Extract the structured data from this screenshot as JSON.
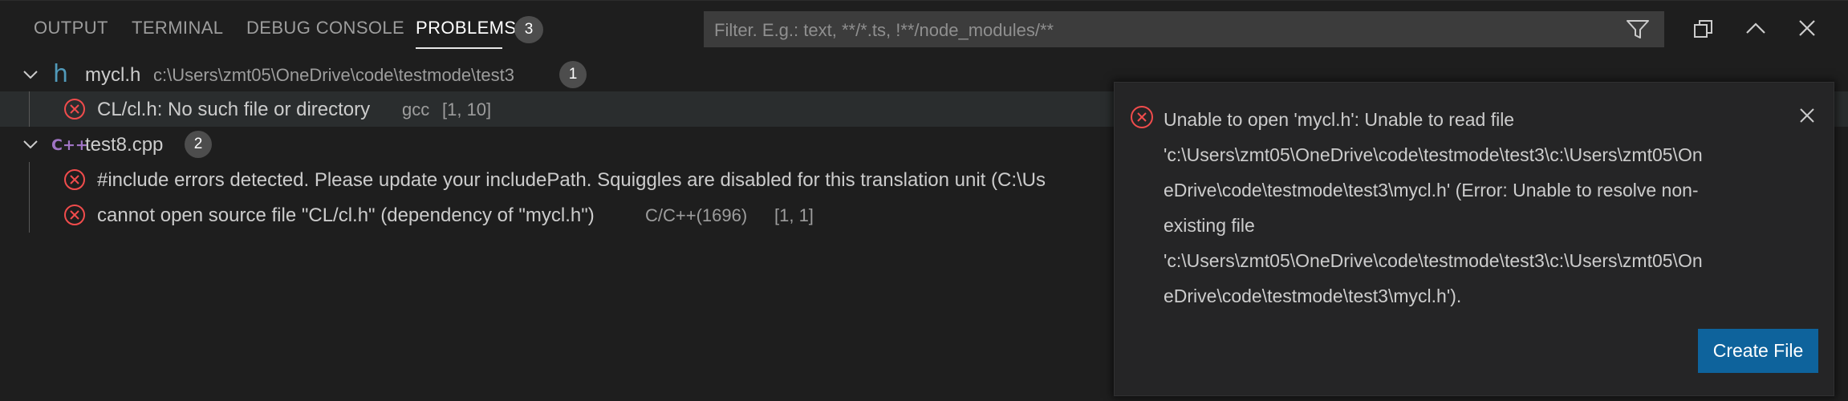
{
  "tabs": {
    "output": "OUTPUT",
    "terminal": "TERMINAL",
    "debug_console": "DEBUG CONSOLE",
    "problems": "PROBLEMS",
    "problems_count": "3"
  },
  "filter": {
    "placeholder": "Filter. E.g.: text, **/*.ts, !**/node_modules/**",
    "value": ""
  },
  "actions": {
    "filter_icon": "filter-icon",
    "restore_icon": "restore-panel-icon",
    "maximize_icon": "chevron-up-icon",
    "close_icon": "close-icon"
  },
  "tree": {
    "files": [
      {
        "name": "mycl.h",
        "path": "c:\\Users\\zmt05\\OneDrive\\code\\testmode\\test3",
        "count": "1",
        "icon_glyph": "h",
        "icon_color": "#519aba",
        "problems": [
          {
            "message": "CL/cl.h: No such file or directory",
            "source": "gcc",
            "location": "[1, 10]"
          }
        ]
      },
      {
        "name": "test8.cpp",
        "count": "2",
        "icon_glyph": "C++",
        "icon_color": "#a074c4",
        "problems": [
          {
            "message": "#include errors detected. Please update your includePath. Squiggles are disabled for this translation unit (C:\\Us"
          },
          {
            "message": "cannot open source file \"CL/cl.h\" (dependency of \"mycl.h\")",
            "source": "C/C++(1696)",
            "location": "[1, 1]"
          }
        ]
      }
    ]
  },
  "notification": {
    "lines": [
      "Unable to open 'mycl.h': Unable to read file",
      "'c:\\Users\\zmt05\\OneDrive\\code\\testmode\\test3\\c:\\Users\\zmt05\\On",
      "eDrive\\code\\testmode\\test3\\mycl.h' (Error: Unable to resolve non-",
      "existing file",
      "'c:\\Users\\zmt05\\OneDrive\\code\\testmode\\test3\\c:\\Users\\zmt05\\On",
      "eDrive\\code\\testmode\\test3\\mycl.h')."
    ],
    "button_label": "Create File"
  },
  "colors": {
    "error": "#f14c4c",
    "badge_bg": "#4d4d4d",
    "button_bg": "#0e639c",
    "panel_bg": "#1e1e1e",
    "selected_row_bg": "#2a2d2e"
  }
}
